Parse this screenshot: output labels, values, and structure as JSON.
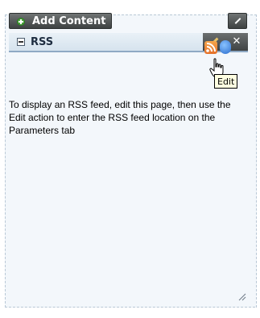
{
  "toolbar": {
    "add_content_label": "Add Content",
    "add_icon": "plus-circle-icon",
    "edit_layout_icon": "pencil-icon"
  },
  "portlet": {
    "title": "RSS",
    "collapse_icon": "collapse-minus-icon",
    "edit_icon": "pencil-icon",
    "close_label": "✕",
    "feed_icons": [
      "rss-icon",
      "globe-icon"
    ],
    "tooltip": "Edit",
    "message": "To display an RSS feed, edit this page, then use the Edit action to enter the RSS feed location on the Parameters tab"
  },
  "colors": {
    "panel_bg": "#f3f7fb",
    "button_dark": "#3e4242",
    "header_bg": "#d6e3ee",
    "tooltip_bg": "#ffffe1",
    "rss_orange": "#e4702a"
  }
}
